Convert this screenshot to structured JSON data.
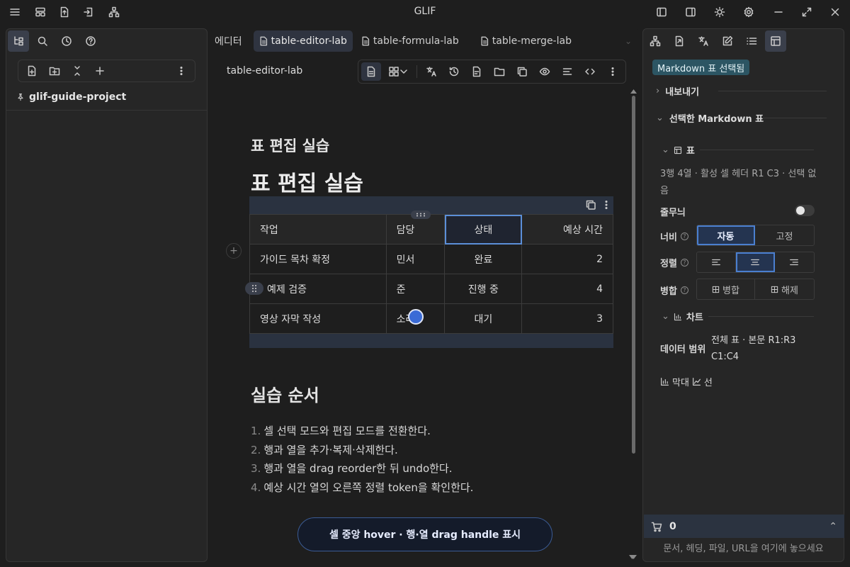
{
  "app": {
    "title": "GLIF"
  },
  "left_panel": {
    "project_name": "glif-guide-project"
  },
  "editor": {
    "tabs": [
      {
        "label": "에디터",
        "active": false
      },
      {
        "label": "table-editor-lab",
        "active": true
      },
      {
        "label": "table-formula-lab",
        "active": false
      },
      {
        "label": "table-merge-lab",
        "active": false
      }
    ],
    "doc_title": "table-editor-lab",
    "heading3": "표 편집 실습",
    "heading1": "표 편집 실습",
    "table": {
      "headers": [
        "작업",
        "담당",
        "상태",
        "예상 시간"
      ],
      "rows": [
        [
          "가이드 목차 확정",
          "민서",
          "완료",
          "2"
        ],
        [
          "예제 검증",
          "준",
          "진행 중",
          "4"
        ],
        [
          "영상 자막 작성",
          "소라",
          "대기",
          "3"
        ]
      ],
      "add_row_label": "+"
    },
    "heading2": "실습 순서",
    "steps": [
      "셀 선택 모드와 편집 모드를 전환한다.",
      "행과 열을 추가·복제·삭제한다.",
      "행과 열을 drag reorder한 뒤 undo한다.",
      "예상 시간 열의 오른쪽 정렬 token을 확인한다."
    ],
    "toast": "셀 중앙 hover · 행·열 drag handle 표시"
  },
  "right_panel": {
    "badge": "Markdown 표 선택됨",
    "export_label": "내보내기",
    "selected_table_label": "선택한 Markdown 표",
    "table_section_label": "표",
    "table_desc": "3행 4열 · 활성 셀 헤더 R1 C3 · 선택 없음",
    "zebra_label": "줄무늬",
    "width_label": "너비",
    "width_options": [
      "자동",
      "고정"
    ],
    "align_label": "정렬",
    "merge_label": "병합",
    "merge_options": [
      "병합",
      "해제"
    ],
    "chart_section_label": "차트",
    "data_range_label": "데이터 범위",
    "data_range_value": "전체 표 · 본문 R1:R3 C1:C4",
    "chart_bar_label": "막대",
    "chart_line_label": "선",
    "basket_count": "0",
    "drop_hint": "문서, 헤딩, 파일, URL을 여기에 놓으세요"
  },
  "colors": {
    "accent": "#4a7fd0",
    "badge_bg": "#2c5563",
    "toast_border": "#3b5b94"
  }
}
